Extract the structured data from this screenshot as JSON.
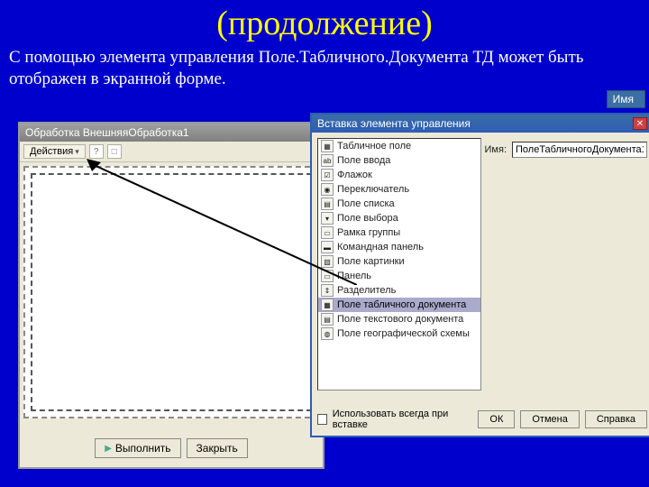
{
  "slide": {
    "title": "(продолжение)",
    "subtitle_a": "С помощью элемента управления ",
    "subtitle_b": "Поле.Табличного.Документа ",
    "subtitle_c": "ТД может быть отображен в экранной форме."
  },
  "prop_panel_label": "Имя",
  "form": {
    "title": "Обработка ВнешняяОбработка1",
    "actions_label": "Действия",
    "btn_execute": "Выполнить",
    "btn_close": "Закрыть"
  },
  "dialog": {
    "title": "Вставка элемента управления",
    "name_label": "Имя:",
    "name_value": "ПолеТабличногоДокумента1",
    "use_always": "Использовать всегда при вставке",
    "ok": "ОК",
    "cancel": "Отмена",
    "help": "Справка",
    "items": [
      "Табличное поле",
      "Поле ввода",
      "Флажок",
      "Переключатель",
      "Поле списка",
      "Поле выбора",
      "Рамка группы",
      "Командная панель",
      "Поле картинки",
      "Панель",
      "Разделитель",
      "Поле табличного документа",
      "Поле текстового документа",
      "Поле географической схемы"
    ],
    "selected_index": 11,
    "icons": [
      "▦",
      "ab",
      "☑",
      "◉",
      "▤",
      "▾",
      "▭",
      "▬",
      "▧",
      "▭",
      "⇕",
      "▦",
      "▤",
      "◍"
    ]
  }
}
